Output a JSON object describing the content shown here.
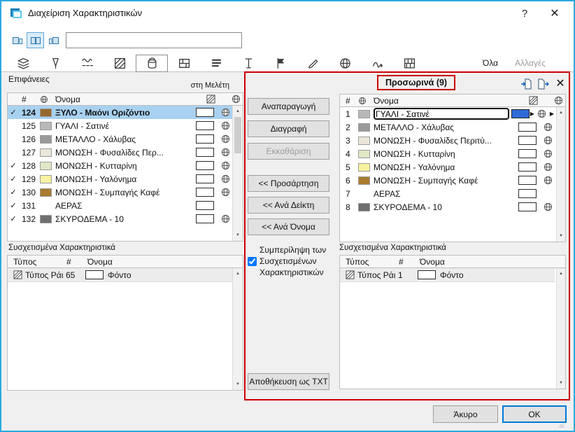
{
  "glyphs": {
    "up": "▲",
    "down": "▼",
    "right": "▶"
  },
  "window": {
    "title": "Διαχείριση Χαρακτηριστικών",
    "help_label": "?",
    "close_label": "✕"
  },
  "toolbar": {
    "search_value": "",
    "view_icons": [
      "left-panel-view",
      "dual-panel-view",
      "right-panel-view"
    ]
  },
  "tabbar": {
    "icon_tabs": [
      "layers",
      "pens",
      "line-types",
      "fill-types",
      "surfaces",
      "composites",
      "profiles",
      "text-styles",
      "zone-categories",
      "brushes",
      "cities",
      "change-marks",
      "building-materials"
    ],
    "selected_tab": "surfaces",
    "all_label": "Όλα",
    "changes_label": "Αλλαγές"
  },
  "columns": {
    "index": "#",
    "name": "Όνομα"
  },
  "assoc_columns": {
    "type": "Τύπος",
    "index": "#",
    "name": "Όνομα"
  },
  "left_panel": {
    "title": "Επιφάνειες",
    "scope_label": "στη Μελέτη",
    "rows": [
      {
        "check": "✓",
        "index": "124",
        "color": "#96682e",
        "name": "ΞΥΛΟ - Μαόνι Οριζόντιο",
        "selected": true
      },
      {
        "check": "",
        "index": "125",
        "color": "#b9b9b9",
        "name": "ΓΥΑΛΙ - Σατινέ"
      },
      {
        "check": "",
        "index": "126",
        "color": "#9a9a9a",
        "name": "ΜΕΤΑΛΛΟ - Χάλυβας"
      },
      {
        "check": "",
        "index": "127",
        "color": "#eae7da",
        "name": "ΜΟΝΩΣΗ - Φυσαλίδες Περ..."
      },
      {
        "check": "✓",
        "index": "128",
        "color": "#e0e8c6",
        "name": "ΜΟΝΩΣΗ - Κυτταρίνη"
      },
      {
        "check": "✓",
        "index": "129",
        "color": "#f6f2a0",
        "name": "ΜΟΝΩΣΗ - Υαλόνημα"
      },
      {
        "check": "✓",
        "index": "130",
        "color": "#a87b2e",
        "name": "ΜΟΝΩΣΗ - Συμπαγής Καφέ"
      },
      {
        "check": "✓",
        "index": "131",
        "color": "",
        "name": "ΑΕΡΑΣ"
      },
      {
        "check": "✓",
        "index": "132",
        "color": "#6f6f6f",
        "name": "ΣΚΥΡΟΔΕΜΑ - 10"
      }
    ],
    "associated": {
      "title": "Συσχετισμένα Χαρακτηριστικά",
      "rows": [
        {
          "type": "Τύπος Ράι",
          "index": "65",
          "name": "Φόντο"
        }
      ]
    }
  },
  "actions": {
    "duplicate": "Αναπαραγωγή",
    "delete": "Διαγραφή",
    "purge": "Εκκαθάριση",
    "append": "<< Προσάρτηση",
    "by_index": "<< Ανά Δείκτη",
    "by_name": "<< Ανά Όνομα",
    "include_line1": "Συμπερίληψη των",
    "include_line2": "Συσχετισμένων",
    "include_line3": "Χαρακτηριστικών",
    "save_txt": "Αποθήκευση ως TXT"
  },
  "right_panel": {
    "title": "Προσωρινά (9)",
    "close_label": "✕",
    "edit_row": {
      "index": "1",
      "color": "#b9b9b9",
      "value": "ΓΥΑΛΙ - Σατινέ",
      "fill_color": "#2e6bd6"
    },
    "rows": [
      {
        "index": "2",
        "color": "#9a9a9a",
        "name": "ΜΕΤΑΛΛΟ - Χάλυβας"
      },
      {
        "index": "3",
        "color": "#eae7da",
        "name": "ΜΟΝΩΣΗ - Φυσαλίδες Περιτύ..."
      },
      {
        "index": "4",
        "color": "#e0e8c6",
        "name": "ΜΟΝΩΣΗ - Κυτταρίνη"
      },
      {
        "index": "5",
        "color": "#f6f2a0",
        "name": "ΜΟΝΩΣΗ - Υαλόνημα"
      },
      {
        "index": "6",
        "color": "#a87b2e",
        "name": "ΜΟΝΩΣΗ - Συμπαγής Καφέ"
      },
      {
        "index": "7",
        "color": "",
        "name": "ΑΕΡΑΣ"
      },
      {
        "index": "8",
        "color": "#6f6f6f",
        "name": "ΣΚΥΡΟΔΕΜΑ - 10"
      }
    ],
    "associated": {
      "title": "Συσχετισμένα Χαρακτηριστικά",
      "rows": [
        {
          "type": "Τύπος Ράι",
          "index": "1",
          "name": "Φόντο"
        }
      ]
    }
  },
  "footer": {
    "cancel": "Άκυρο",
    "ok": "OK"
  },
  "watermark": ".ai",
  "annotation_color": "#cc0000"
}
